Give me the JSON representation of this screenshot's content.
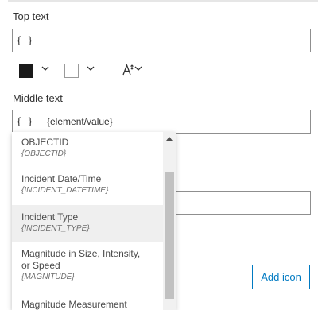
{
  "top_text": {
    "label": "Top text",
    "value": "",
    "brace_label": "{ }"
  },
  "style_row": {
    "text_color": "#1a1a1a",
    "background_color": "#ffffff",
    "text_size_icon": "A↕"
  },
  "middle_text": {
    "label": "Middle text",
    "value": "{element/value}",
    "brace_label": "{ }"
  },
  "dropdown": {
    "items": [
      {
        "title": "OBJECTID",
        "sub": "{OBJECTID}",
        "highlighted": false
      },
      {
        "title": "Incident Date/Time",
        "sub": "{INCIDENT_DATETIME}",
        "highlighted": false
      },
      {
        "title": "Incident Type",
        "sub": "{INCIDENT_TYPE}",
        "highlighted": true
      },
      {
        "title_line1": "Magnitude in Size, Intensity,",
        "title_line2": "or Speed",
        "sub": "{MAGNITUDE}",
        "highlighted": false
      },
      {
        "title": "Magnitude Measurement",
        "sub": "",
        "highlighted": false
      }
    ]
  },
  "add_icon_button": {
    "label": "Add icon"
  },
  "colors": {
    "accent": "#007ac2",
    "highlight": "#efefef"
  }
}
